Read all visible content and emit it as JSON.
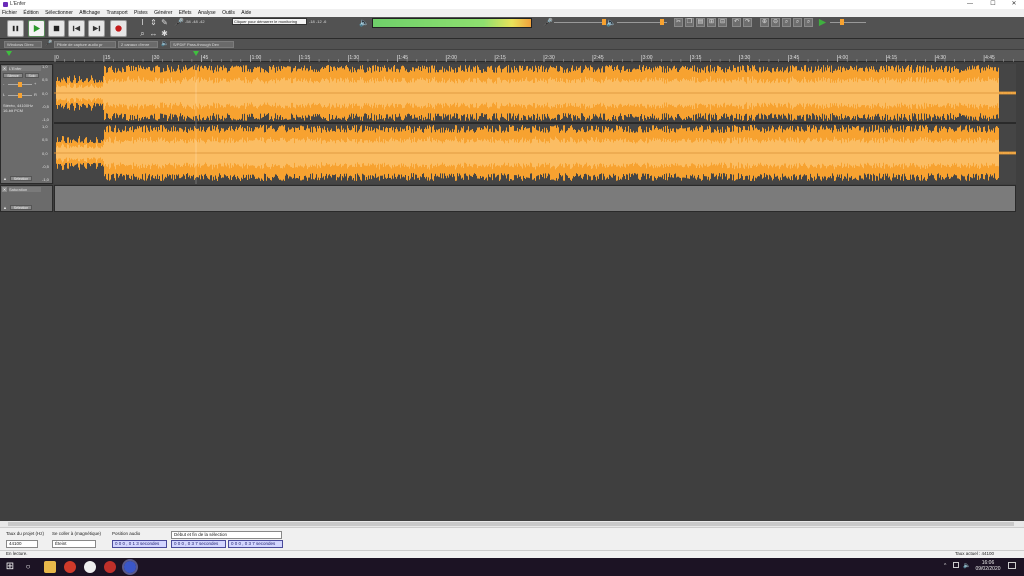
{
  "window": {
    "title": "L'Enfer",
    "minimize": "—",
    "maximize": "☐",
    "close": "✕"
  },
  "menu": [
    "Fichier",
    "Édition",
    "Sélectionner",
    "Affichage",
    "Transport",
    "Pistes",
    "Générer",
    "Effets",
    "Analyse",
    "Outils",
    "Aide"
  ],
  "meters": {
    "record_hint": "Cliquer pour démarrer le monitoring",
    "record_scale": [
      "-54",
      "-48",
      "-42",
      "-36",
      "-30",
      "-24",
      "-18",
      "-12",
      "-6"
    ],
    "playback_scale": [
      "-54",
      "-48",
      "-42",
      "-36",
      "-30",
      "-24",
      "-18",
      "-12",
      "-6",
      "0"
    ]
  },
  "devices": {
    "host": "Windows Direc",
    "record_device": "Pilote de capture audio pr",
    "channels": "2 canaux d'enre",
    "playback_device": "S/PDIF Pass-through Dev"
  },
  "ruler": {
    "labels": [
      "0",
      "15",
      "30",
      "45",
      "1:00",
      "1:15",
      "1:30",
      "1:45",
      "2:00",
      "2:15",
      "2:30",
      "2:45",
      "3:00",
      "3:15",
      "3:30",
      "3:45",
      "4:00",
      "4:15",
      "4:30",
      "4:45"
    ]
  },
  "track": {
    "name": "L'Enfer",
    "mute": "Silence",
    "solo": "Solo",
    "info_line1": "Stéréo, 44100Hz",
    "info_line2": "16-bit PCM",
    "select": "Sélection",
    "scale": [
      "1,0",
      "0,5",
      "0,0",
      "-0,5",
      "-1,0"
    ],
    "pan_left": "L",
    "pan_right": "R",
    "gain_minus": "-",
    "gain_plus": "+"
  },
  "label_track": {
    "name": "Saturation",
    "select": "Sélection"
  },
  "selection_bar": {
    "rate_label": "Taux du projet (Hz)",
    "rate_value": "44100",
    "snap_label": "Se coller à (magnétique)",
    "snap_value": "Éteint",
    "pos_label": "Position audio",
    "pos_value": "0 0 0 , 0 1 3",
    "range_label": "Début et fin de la sélection",
    "start_value": "0 0 0 , 0 3 7",
    "end_value": "0 0 0 , 0 3 7",
    "unit": "secondes"
  },
  "status": {
    "left": "En lecture.",
    "right": "Taux actuel : 44100"
  },
  "taskbar": {
    "time": "16:06",
    "date": "09/02/2020"
  },
  "colors": {
    "waveform": "#f7a230",
    "waveform_rms": "#fbbd63",
    "meter_green": "#7ed96a"
  }
}
